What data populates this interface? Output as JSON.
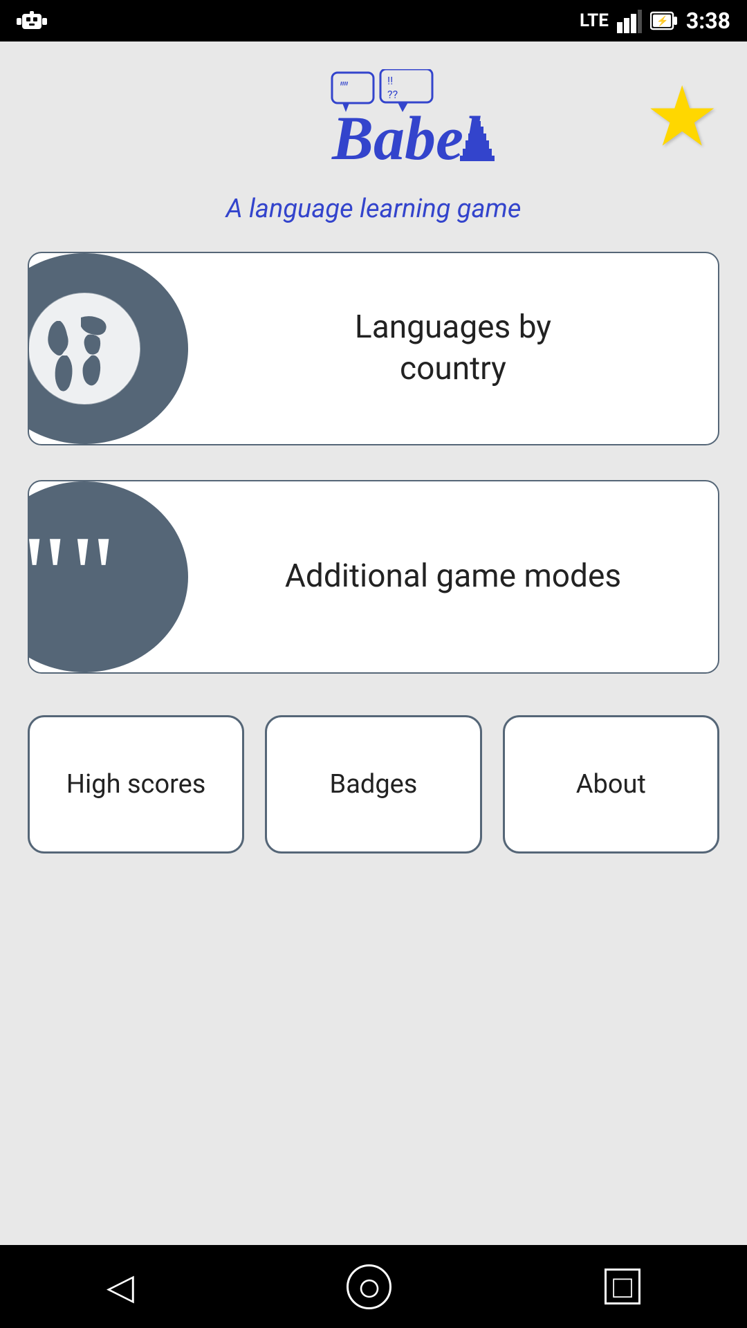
{
  "statusBar": {
    "time": "3:38",
    "signal": "LTE",
    "battery": "⚡",
    "robotIcon": "🤖"
  },
  "header": {
    "appName": "Babel",
    "subtitle": "A language learning game",
    "starIcon": "★"
  },
  "menuCards": [
    {
      "id": "languages-by-country",
      "label": "Languages by\ncountry",
      "icon": "globe"
    },
    {
      "id": "additional-game-modes",
      "label": "Additional game modes",
      "icon": "quotes"
    }
  ],
  "bottomButtons": [
    {
      "id": "high-scores",
      "label": "High scores"
    },
    {
      "id": "badges",
      "label": "Badges"
    },
    {
      "id": "about",
      "label": "About"
    }
  ],
  "navBar": {
    "back": "◁",
    "home": "○",
    "recent": "□"
  },
  "colors": {
    "accent": "#556677",
    "blue": "#3344cc",
    "star": "#FFD700"
  }
}
